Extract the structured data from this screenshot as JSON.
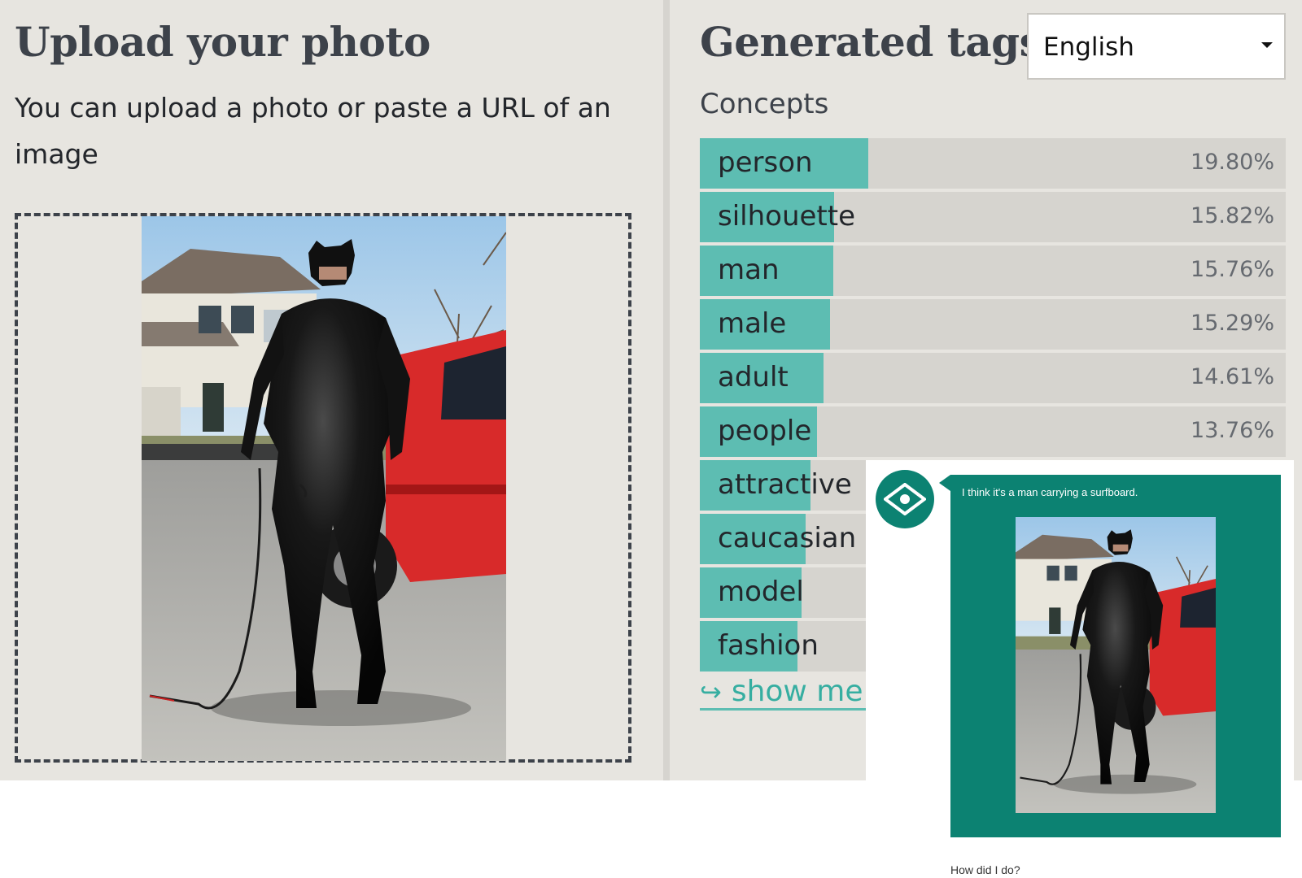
{
  "upload": {
    "title": "Upload your photo",
    "description": "You can upload a photo or paste a URL of an image"
  },
  "tags": {
    "title": "Generated tags",
    "language": "English",
    "concepts_label": "Concepts",
    "items": [
      {
        "label": "person",
        "pct": "19.80%",
        "value": 0.198
      },
      {
        "label": "silhouette",
        "pct": "15.82%",
        "value": 0.1582
      },
      {
        "label": "man",
        "pct": "15.76%",
        "value": 0.1576
      },
      {
        "label": "male",
        "pct": "15.29%",
        "value": 0.1529
      },
      {
        "label": "adult",
        "pct": "14.61%",
        "value": 0.1461
      },
      {
        "label": "people",
        "pct": "13.76%",
        "value": 0.1376
      },
      {
        "label": "attractive",
        "pct": "",
        "value": 0.13
      },
      {
        "label": "caucasian",
        "pct": "",
        "value": 0.125
      },
      {
        "label": "model",
        "pct": "",
        "value": 0.12
      },
      {
        "label": "fashion",
        "pct": "",
        "value": 0.115
      }
    ],
    "show_more": "show me",
    "show_more_icon": "return-arrow-icon"
  },
  "overlay": {
    "caption": "I think it's a man carrying a surfboard.",
    "footer": "How did I do?",
    "avatar_icon": "eye-icon"
  },
  "colors": {
    "accent": "#5dbdb2",
    "bubble": "#0c8272",
    "background": "#e7e5e0"
  }
}
